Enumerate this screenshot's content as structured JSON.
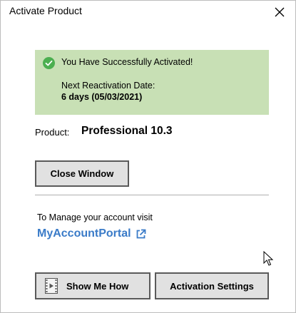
{
  "window": {
    "title": "Activate Product",
    "close_glyph": "×"
  },
  "status": {
    "message": "You Have Successfully Activated!",
    "next_label": "Next Reactivation Date:",
    "next_value": "6 days (05/03/2021)",
    "panel_color": "#c8e0b5",
    "icon": "check-circle-icon",
    "icon_color": "#4caf50"
  },
  "product": {
    "label": "Product:",
    "value": "Professional 10.3"
  },
  "buttons": {
    "close_window": "Close Window",
    "show_me_how": "Show Me How",
    "activation_settings": "Activation Settings"
  },
  "account": {
    "manage_label": "To Manage your account visit",
    "portal_link": "MyAccountPortal",
    "link_color": "#3a7bc8",
    "link_icon": "external-link-icon"
  }
}
